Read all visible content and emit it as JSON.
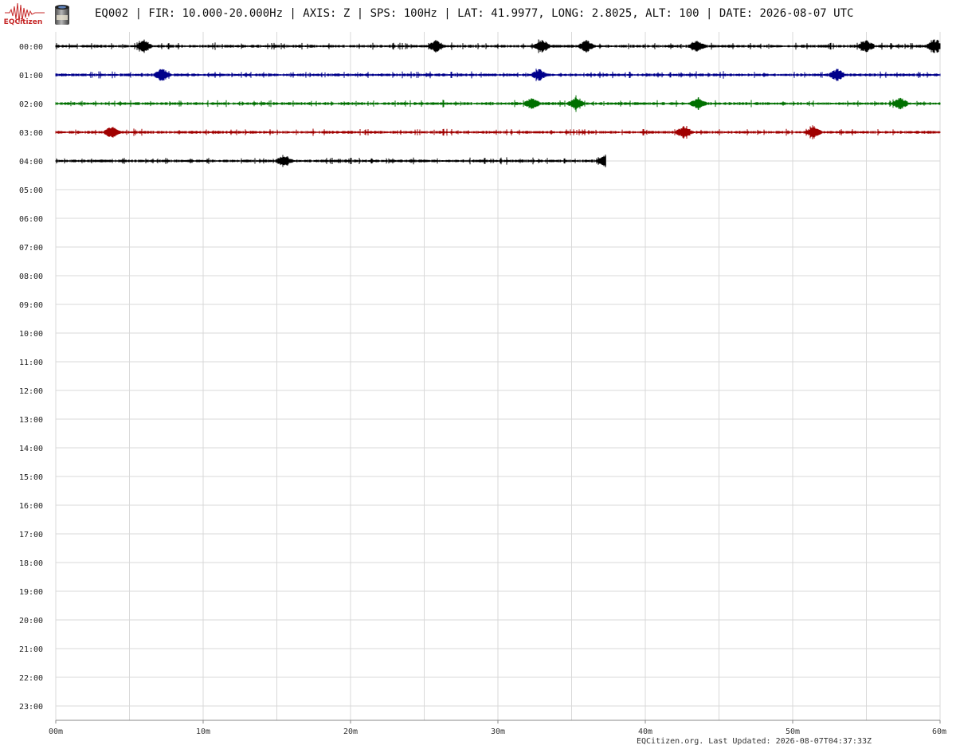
{
  "header": {
    "logo_text": "EQCitizen",
    "title": "EQ002 | FIR: 10.000-20.000Hz | AXIS: Z | SPS: 100Hz | LAT: 41.9977, LONG: 2.8025, ALT: 100 | DATE: 2026-08-07 UTC"
  },
  "footer": {
    "text": "EQCitizen.org. Last Updated: 2026-08-07T04:37:33Z"
  },
  "colors": {
    "trace_cycle": [
      "#000000",
      "#00008b",
      "#007000",
      "#a00000"
    ],
    "grid": "#d9d9d9",
    "logo": "#c62828"
  },
  "chart_data": {
    "type": "line",
    "title": "",
    "xlabel": "",
    "ylabel": "",
    "x_unit": "minutes",
    "xlim": [
      0,
      60
    ],
    "x_ticks": [
      "00m",
      "10m",
      "20m",
      "30m",
      "40m",
      "50m",
      "60m"
    ],
    "x_tick_values": [
      0,
      10,
      20,
      30,
      40,
      50,
      60
    ],
    "rows": [
      "00:00",
      "01:00",
      "02:00",
      "03:00",
      "04:00",
      "05:00",
      "06:00",
      "07:00",
      "08:00",
      "09:00",
      "10:00",
      "11:00",
      "12:00",
      "13:00",
      "14:00",
      "15:00",
      "16:00",
      "17:00",
      "18:00",
      "19:00",
      "20:00",
      "21:00",
      "22:00",
      "23:00"
    ],
    "grid": true,
    "series": [
      {
        "row": "00:00",
        "color": "#000000",
        "start_min": 0,
        "end_min": 60,
        "events_min": [
          6.0,
          25.8,
          33.0,
          36.0,
          43.5,
          55.0,
          59.6
        ]
      },
      {
        "row": "01:00",
        "color": "#00008b",
        "start_min": 0,
        "end_min": 60,
        "events_min": [
          7.2,
          32.8,
          53.0
        ]
      },
      {
        "row": "02:00",
        "color": "#007000",
        "start_min": 0,
        "end_min": 60,
        "events_min": [
          32.3,
          35.3,
          43.6,
          57.3
        ]
      },
      {
        "row": "03:00",
        "color": "#a00000",
        "start_min": 0,
        "end_min": 60,
        "events_min": [
          3.8,
          42.6,
          51.4
        ]
      },
      {
        "row": "04:00",
        "color": "#000000",
        "start_min": 0,
        "end_min": 37.3,
        "events_min": [
          15.5,
          37.3
        ]
      }
    ]
  }
}
